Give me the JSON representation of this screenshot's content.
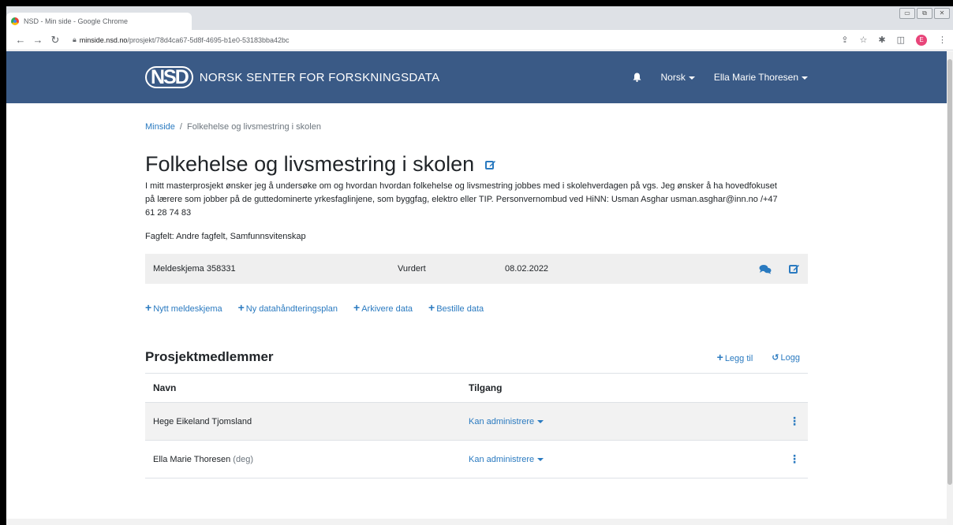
{
  "browser": {
    "tab_title": "NSD - Min side - Google Chrome",
    "url_host": "minside.nsd.no",
    "url_path": "/prosjekt/78d4ca67-5d8f-4695-b1e0-53183bba42bc",
    "profile_initial": "E"
  },
  "navbar": {
    "logo_mark": "NSD",
    "logo_name": "NORSK SENTER FOR FORSKNINGSDATA",
    "language": "Norsk",
    "user": "Ella Marie Thoresen"
  },
  "breadcrumb": {
    "root": "Minside",
    "separator": "/",
    "current": "Folkehelse og livsmestring i skolen"
  },
  "project": {
    "title": "Folkehelse og livsmestring i skolen",
    "description": "I mitt masterprosjekt ønsker jeg å undersøke om og hvordan hvordan folkehelse og livsmestring jobbes med i skolehverdagen på vgs. Jeg ønsker å ha hovedfokuset på lærere som jobber på de guttedominerte yrkesfaglinjene, som byggfag, elektro eller TIP. Personvernombud ved HiNN: Usman Asghar usman.asghar@inn.no /+47 61 28 74 83",
    "field": "Fagfelt: Andre fagfelt, Samfunnsvitenskap"
  },
  "form_row": {
    "name": "Meldeskjema 358331",
    "status": "Vurdert",
    "date": "08.02.2022"
  },
  "actions": [
    {
      "label": "Nytt meldeskjema"
    },
    {
      "label": "Ny datahåndteringsplan"
    },
    {
      "label": "Arkivere data"
    },
    {
      "label": "Bestille data"
    }
  ],
  "members": {
    "heading": "Prosjektmedlemmer",
    "add_label": "Legg til",
    "log_label": "Logg",
    "columns": {
      "name": "Navn",
      "access": "Tilgang"
    },
    "rows": [
      {
        "name": "Hege Eikeland Tjomsland",
        "suffix": "",
        "access": "Kan administrere"
      },
      {
        "name": "Ella Marie Thoresen",
        "suffix": "(deg)",
        "access": "Kan administrere"
      }
    ]
  },
  "colors": {
    "navbar": "#3a5a86",
    "link": "#2a7ac0"
  }
}
